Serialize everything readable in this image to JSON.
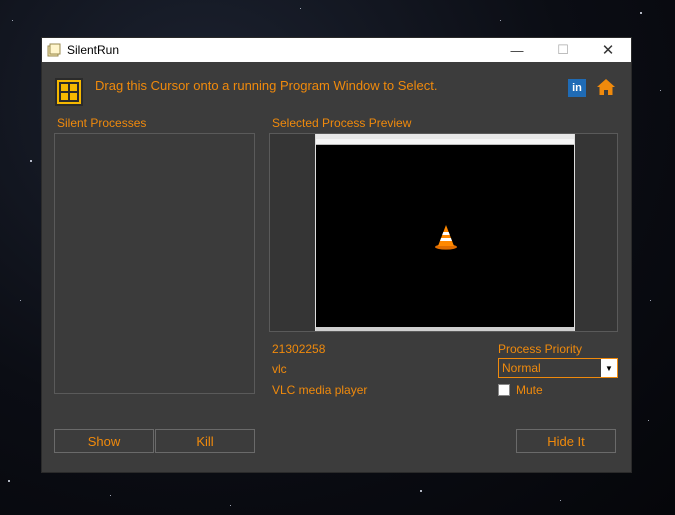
{
  "window": {
    "title": "SilentRun",
    "minimize": "—",
    "maximize": "☐",
    "close": "✕"
  },
  "header": {
    "instruction": "Drag this Cursor onto a running Program Window to Select."
  },
  "panels": {
    "silent_processes_label": "Silent Processes",
    "preview_label": "Selected Process Preview"
  },
  "process": {
    "id": "21302258",
    "name": "vlc",
    "window_title": "VLC media player"
  },
  "priority": {
    "label": "Process Priority",
    "value": "Normal"
  },
  "mute": {
    "label": "Mute",
    "checked": false
  },
  "buttons": {
    "show": "Show",
    "kill": "Kill",
    "hide": "Hide It"
  },
  "colors": {
    "accent": "#f08a0c",
    "panel": "#3c3c3c",
    "cursor_target": "#f5b800",
    "linkedin": "#1f6bb5"
  },
  "icons": {
    "app": "app-icon",
    "cursor": "crosshair-icon",
    "linkedin": "linkedin-icon",
    "home": "home-icon",
    "vlc": "vlc-cone-icon"
  }
}
